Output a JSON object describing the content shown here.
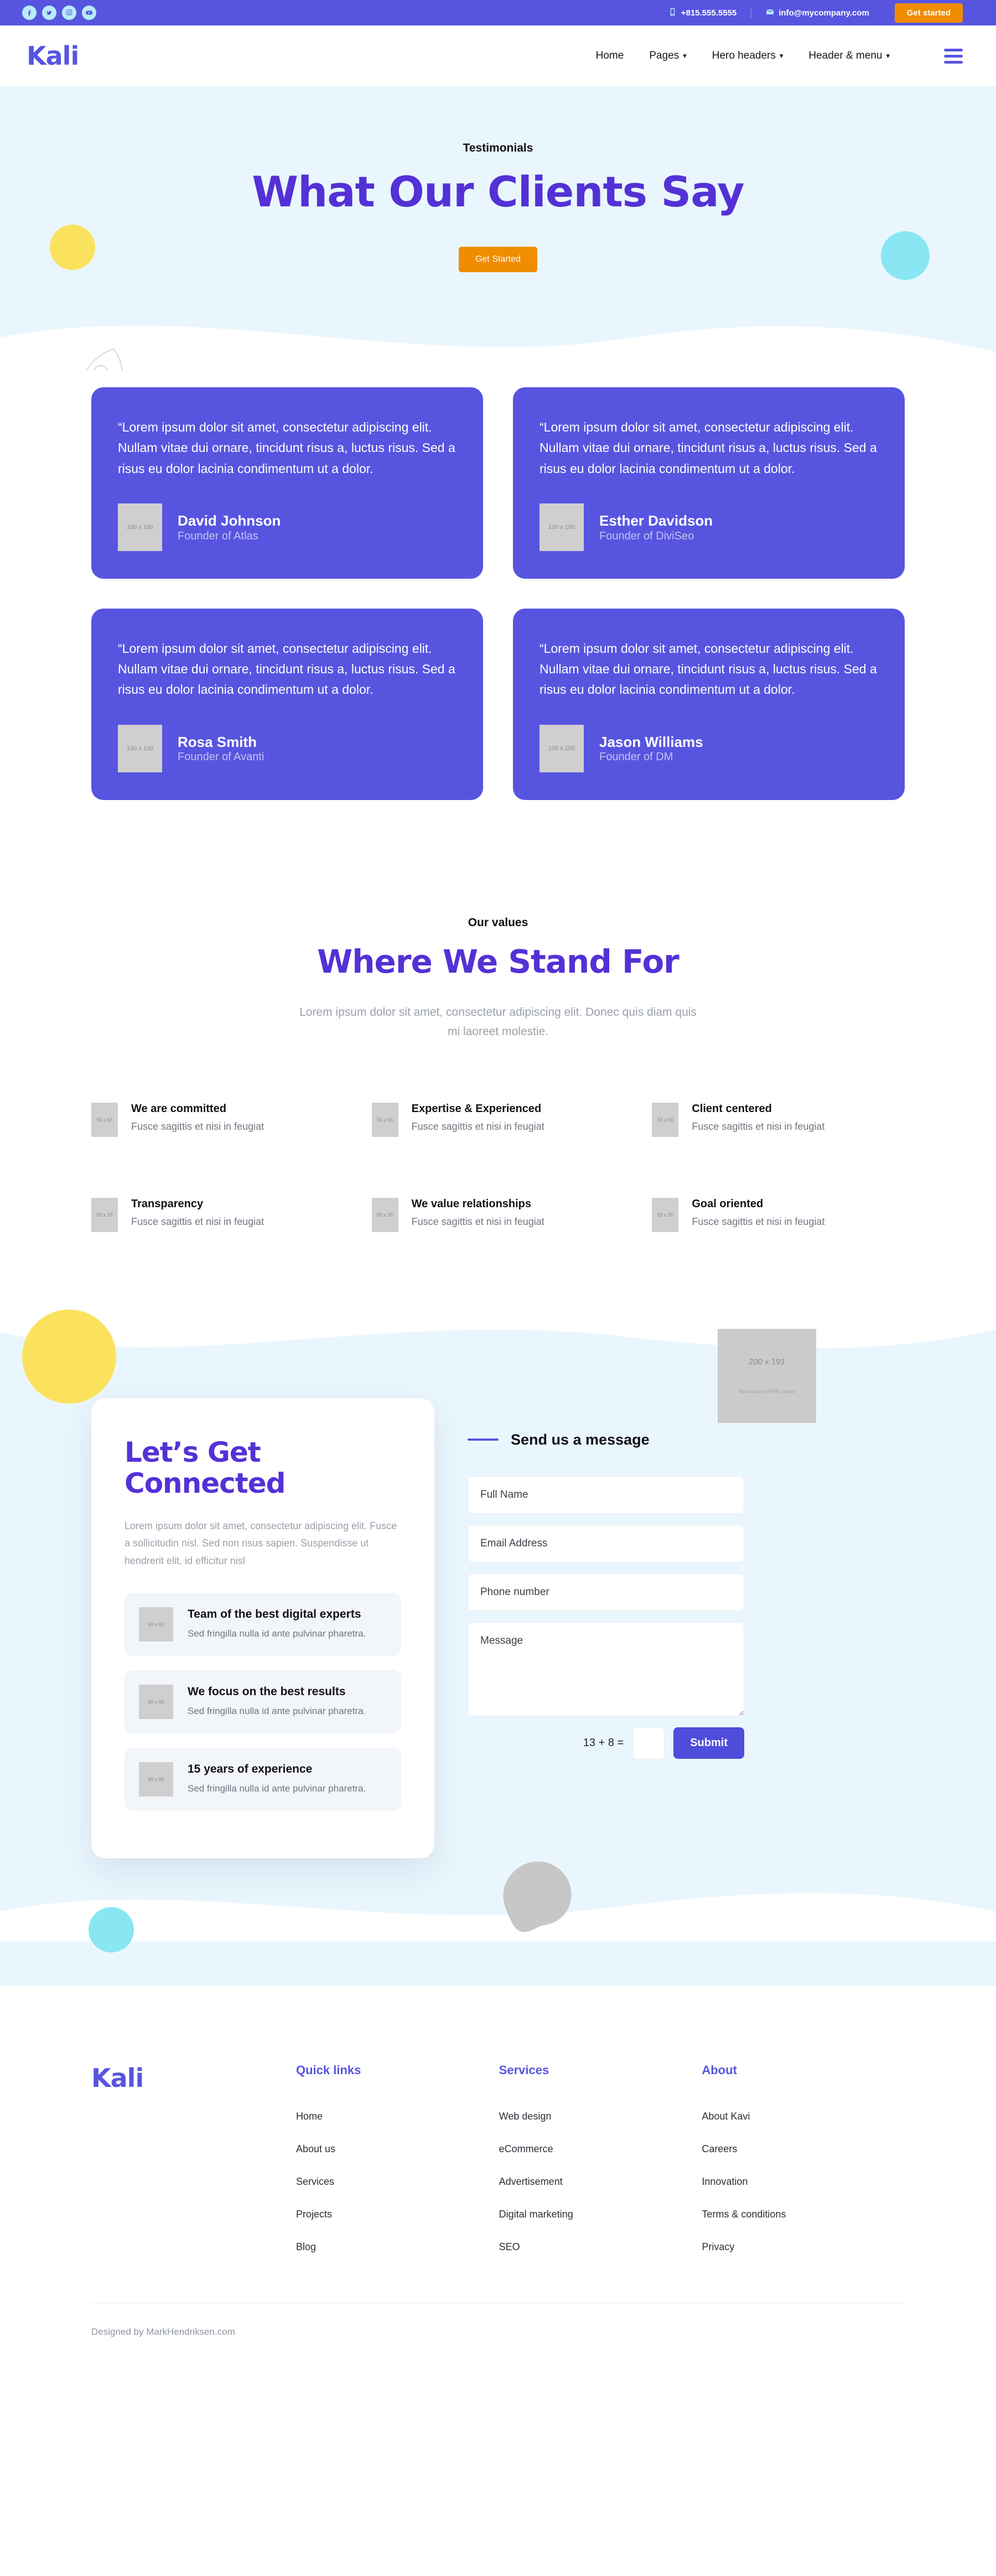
{
  "topbar": {
    "socials": [
      {
        "name": "facebook-icon"
      },
      {
        "name": "twitter-icon"
      },
      {
        "name": "instagram-icon"
      },
      {
        "name": "youtube-icon"
      }
    ],
    "phone": "+815.555.5555",
    "email": "info@mycompany.com",
    "cta": "Get started",
    "bg_color": "#5755e0",
    "cta_color": "#f08c00"
  },
  "nav": {
    "brand": "Kali",
    "links": [
      {
        "label": "Home",
        "has_caret": false
      },
      {
        "label": "Pages",
        "has_caret": true
      },
      {
        "label": "Hero headers",
        "has_caret": true
      },
      {
        "label": "Header & menu",
        "has_caret": true
      }
    ]
  },
  "hero": {
    "eyebrow": "Testimonials",
    "title": "What Our Clients Say",
    "button": "Get Started",
    "bg_color": "#eaf6fd",
    "title_color": "#5331d6"
  },
  "testimonials": [
    {
      "quote": "“Lorem ipsum dolor sit amet, consectetur adipiscing elit. Nullam vitae dui ornare, tincidunt risus a, luctus risus. Sed a risus eu dolor lacinia condimentum ut a dolor.",
      "avatar": "100 x 100",
      "name": "David Johnson",
      "role": "Founder of Atlas"
    },
    {
      "quote": "“Lorem ipsum dolor sit amet, consectetur adipiscing elit. Nullam vitae dui ornare, tincidunt risus a, luctus risus. Sed a risus eu dolor lacinia condimentum ut a dolor.",
      "avatar": "100 x 100",
      "name": "Esther Davidson",
      "role": "Founder of DiviSeo"
    },
    {
      "quote": "“Lorem ipsum dolor sit amet, consectetur adipiscing elit. Nullam vitae dui ornare, tincidunt risus a, luctus risus. Sed a risus eu dolor lacinia condimentum ut a dolor.",
      "avatar": "100 x 100",
      "name": "Rosa Smith",
      "role": "Founder of Avanti"
    },
    {
      "quote": "“Lorem ipsum dolor sit amet, consectetur adipiscing elit. Nullam vitae dui ornare, tincidunt risus a, luctus risus. Sed a risus eu dolor lacinia condimentum ut a dolor.",
      "avatar": "100 x 100",
      "name": "Jason Williams",
      "role": "Founder of DM"
    }
  ],
  "values": {
    "eyebrow": "Our values",
    "title": "Where We Stand For",
    "lead": "Lorem ipsum dolor sit amet, consectetur adipiscing elit. Donec quis diam quis mi laoreet molestie.",
    "items": [
      {
        "icon": "55 x 55",
        "title": "We are committed",
        "sub": "Fusce sagittis et nisi in feugiat"
      },
      {
        "icon": "55 x 55",
        "title": "Expertise & Experienced",
        "sub": "Fusce sagittis et nisi in feugiat"
      },
      {
        "icon": "55 x 55",
        "title": "Client centered",
        "sub": "Fusce sagittis et nisi in feugiat"
      },
      {
        "icon": "55 x 55",
        "title": "Transparency",
        "sub": "Fusce sagittis et nisi in feugiat"
      },
      {
        "icon": "55 x 55",
        "title": "We value relationships",
        "sub": "Fusce sagittis et nisi in feugiat"
      },
      {
        "icon": "55 x 55",
        "title": "Goal oriented",
        "sub": "Fusce sagittis et nisi in feugiat"
      }
    ]
  },
  "connect": {
    "banner_placeholder": {
      "size": "200 x 191",
      "caption": "Received by HTML codes"
    },
    "title": "Let’s Get Connected",
    "lead": "Lorem ipsum dolor sit amet, consectetur adipiscing elit. Fusce a sollicitudin nisl. Sed non risus sapien. Suspendisse ut hendrerit elit, id efficitur nisl",
    "features": [
      {
        "icon": "60 x 60",
        "title": "Team of the best digital experts",
        "sub": "Sed fringilla nulla id ante pulvinar pharetra."
      },
      {
        "icon": "60 x 60",
        "title": "We focus on the best results",
        "sub": "Sed fringilla nulla id ante pulvinar pharetra."
      },
      {
        "icon": "60 x 60",
        "title": "15 years of experience",
        "sub": "Sed fringilla nulla id ante pulvinar pharetra."
      }
    ],
    "form": {
      "heading": "Send us a message",
      "full_name_placeholder": "Full Name",
      "full_name_value": "",
      "email_placeholder": "Email Address",
      "email_value": "",
      "phone_placeholder": "Phone number",
      "phone_value": "",
      "message_placeholder": "Message",
      "message_value": "",
      "captcha_question": "13 + 8 =",
      "captcha_value": "",
      "submit_label": "Submit"
    }
  },
  "footer": {
    "brand": "Kali",
    "columns": [
      {
        "title": "Quick links",
        "links": [
          "Home",
          "About us",
          "Services",
          "Projects",
          "Blog"
        ]
      },
      {
        "title": "Services",
        "links": [
          "Web design",
          "eCommerce",
          "Advertisement",
          "Digital marketing",
          "SEO"
        ]
      },
      {
        "title": "About",
        "links": [
          "About Kavi",
          "Careers",
          "Innovation",
          "Terms & conditions",
          "Privacy"
        ]
      }
    ],
    "copyright": "Designed by MarkHendriksen.com"
  }
}
